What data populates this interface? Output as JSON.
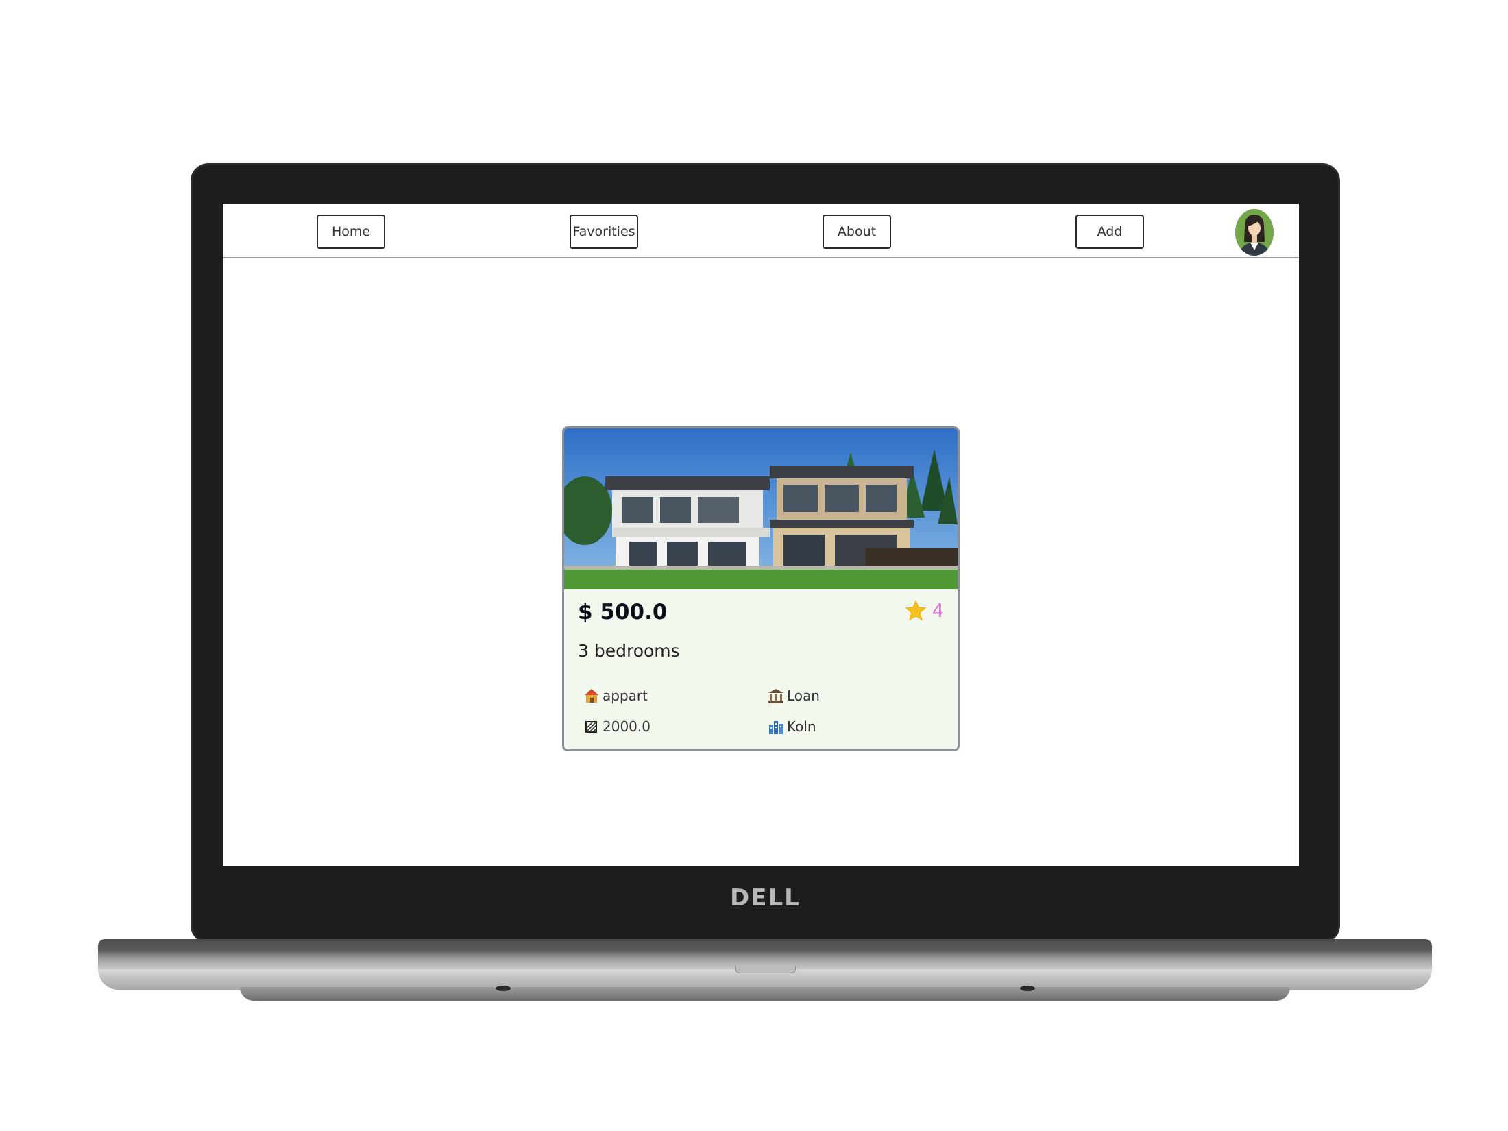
{
  "device": {
    "brand": "DELL"
  },
  "navbar": {
    "home_label": "Home",
    "favorites_label": "Favorities",
    "about_label": "About",
    "add_label": "Add"
  },
  "listing": {
    "price": "$ 500.0",
    "rating": "4",
    "bedrooms": "3 bedrooms",
    "property_type": "appart",
    "transaction_type": "Loan",
    "area": "2000.0",
    "city": "Koln"
  },
  "colors": {
    "rating_color": "#d86bd0",
    "card_background": "#f3f8ef",
    "avatar_background": "#74a74a"
  },
  "icons": {
    "rating": "star-icon",
    "property_type": "house-icon",
    "transaction_type": "bank-icon",
    "area": "area-icon",
    "city": "city-icon"
  }
}
